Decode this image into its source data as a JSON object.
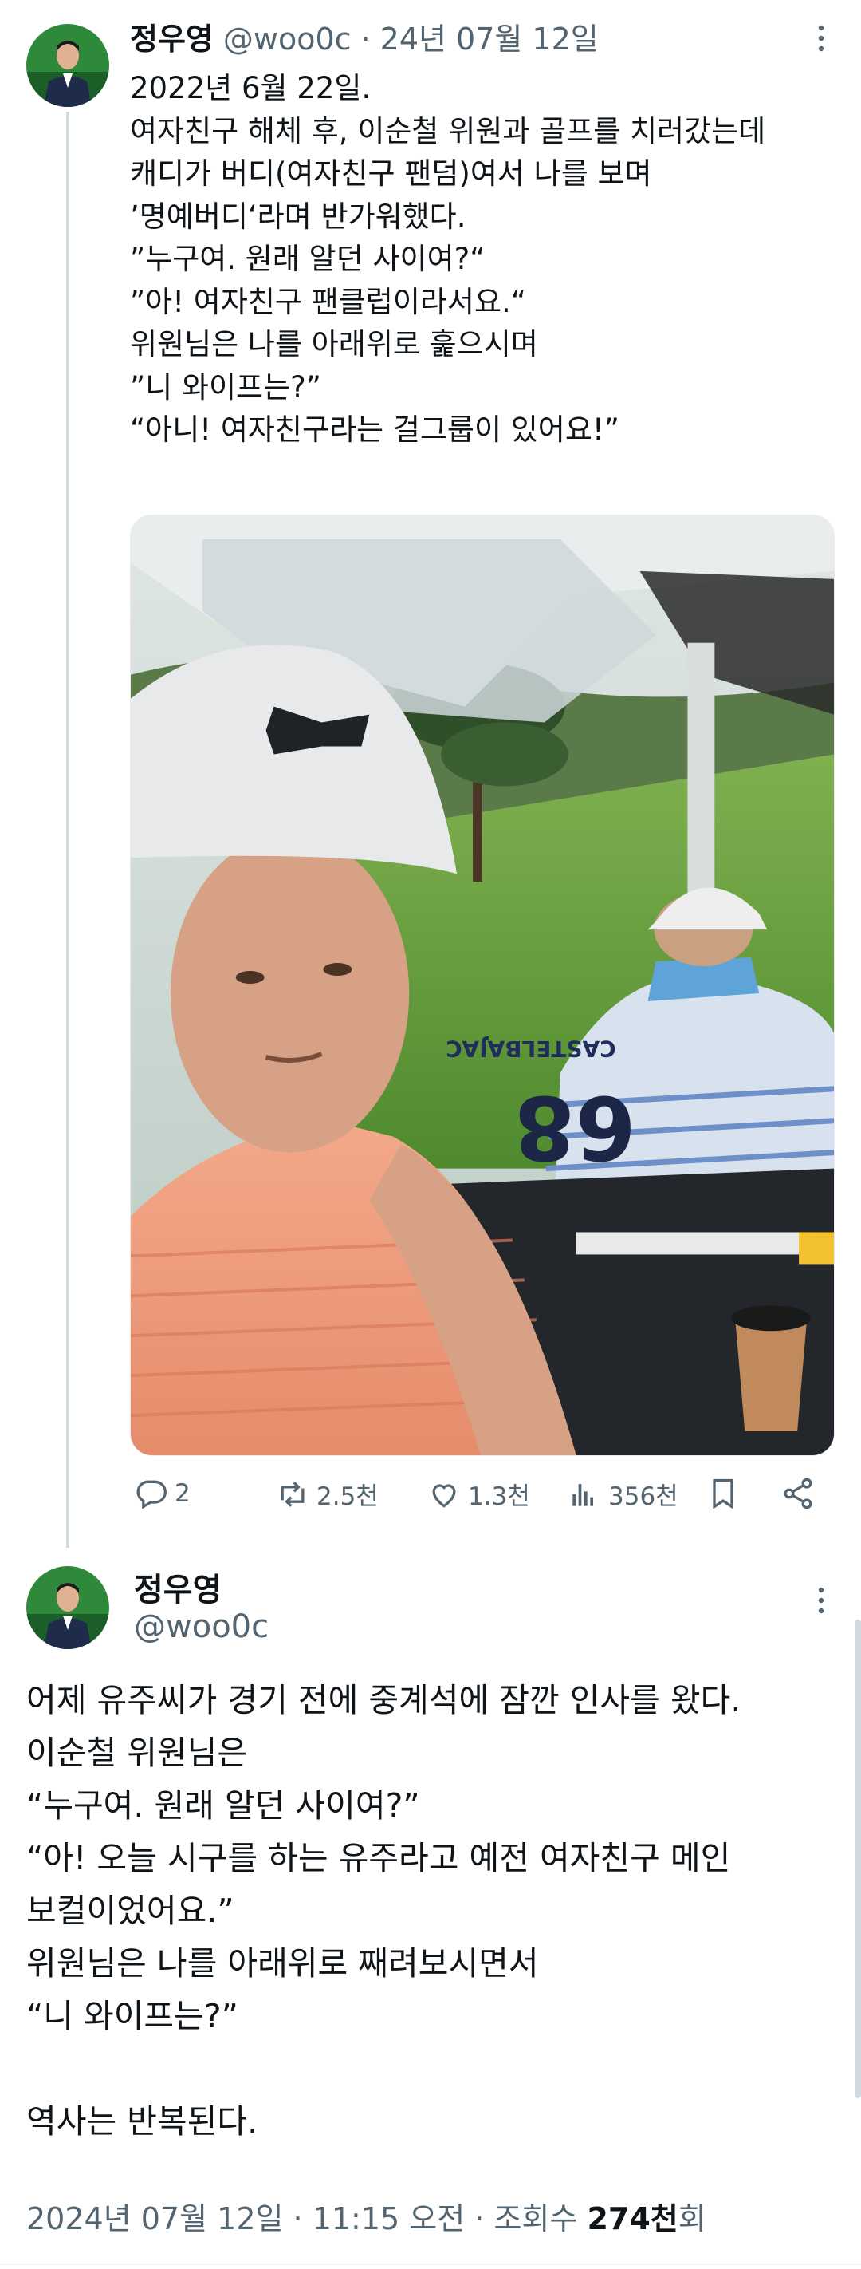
{
  "tweet1": {
    "author_name": "정우영",
    "author_handle": "@woo0c",
    "separator": "·",
    "date": "24년 07월 12일",
    "lines": [
      "2022년 6월 22일.",
      "여자친구 해체 후, 이순철 위원과 골프를 치러갔는데",
      "캐디가 버디(여자친구 팬덤)여서 나를 보며",
      "’명예버디‘라며 반가워했다.",
      "”누구여. 원래 알던 사이여?“",
      "”아! 여자친구 팬클럽이라서요.“",
      "위원님은 나를 아래위로 훑으시며",
      "”니 와이프는?”",
      "“아니! 여자친구라는 걸그룹이 있어요!”"
    ],
    "photo_jersey_text": "CASTELBAJAC",
    "photo_jersey_number": "68",
    "stats": {
      "replies": "2",
      "retweets": "2.5천",
      "likes": "1.3천",
      "views": "356천"
    }
  },
  "tweet2": {
    "author_name": "정우영",
    "author_handle": "@woo0c",
    "lines": [
      "어제 유주씨가 경기 전에 중계석에 잠깐 인사를 왔다.",
      "이순철 위원님은",
      "“누구여. 원래 알던 사이여?”",
      "“아! 오늘 시구를 하는 유주라고 예전 여자친구 메인",
      "보컬이었어요.”",
      "위원님은 나를 아래위로 째려보시면서",
      "“니 와이프는?”",
      "",
      "역사는 반복된다."
    ],
    "timestamp": "2024년 07월 12일 · 11:15 오전",
    "views_prefix": "· 조회수",
    "views_count": "274천",
    "views_suffix": "회"
  },
  "colors": {
    "text": "#0f1419",
    "muted": "#536471",
    "thread_line": "#cfd9de"
  },
  "icons": [
    "more-icon",
    "reply-icon",
    "retweet-icon",
    "like-icon",
    "views-icon",
    "bookmark-icon",
    "share-icon"
  ]
}
